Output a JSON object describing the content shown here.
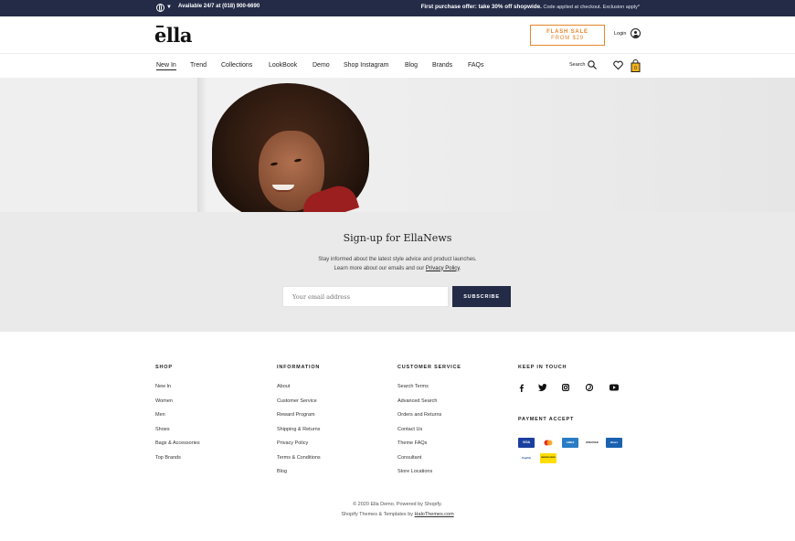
{
  "topbar": {
    "availability": "Available 24/7 at (018) 900-6690",
    "offer_main": "First purchase offer: take 30% off shopwide.",
    "offer_note": "Code applied at checkout. Exclusion apply*"
  },
  "header": {
    "logo": "ella",
    "flash_sale": {
      "line1": "FLASH SALE",
      "line2": "FROM $29"
    },
    "login": "Login"
  },
  "nav": {
    "items": [
      "New In",
      "Trend",
      "Collections",
      "LookBook",
      "Demo",
      "Shop Instagram",
      "Blog",
      "Brands",
      "FAQs"
    ],
    "search_label": "Search"
  },
  "newsletter": {
    "title": "Sign-up for EllaNews",
    "line1": "Stay informed about the latest style advice and product launches.",
    "line2": "Learn more about our emails and our",
    "privacy_link": "Privacy Policy",
    "line2_end": ".",
    "email_placeholder": "Your email address",
    "subscribe": "SUBSCRIBE"
  },
  "footer": {
    "shop": {
      "title": "SHOP",
      "links": [
        "New In",
        "Women",
        "Men",
        "Shoes",
        "Bags & Accessories",
        "Top Brands"
      ]
    },
    "information": {
      "title": "INFORMATION",
      "links": [
        "About",
        "Customer Service",
        "Reward Program",
        "Shipping & Returns",
        "Privacy Policy",
        "Terms & Conditions",
        "Blog"
      ]
    },
    "customer_service": {
      "title": "CUSTOMER SERVICE",
      "links": [
        "Search Terms",
        "Advanced Search",
        "Orders and Returns",
        "Contact Us",
        "Theme FAQs",
        "Consultant",
        "Store Locations"
      ]
    },
    "keep_in_touch": {
      "title": "KEEP IN TOUCH",
      "icons": [
        "facebook-icon",
        "twitter-icon",
        "instagram-icon",
        "pinterest-icon",
        "youtube-icon"
      ]
    },
    "payment": {
      "title": "PAYMENT ACCEPT",
      "cards": [
        "VISA",
        "mastercard",
        "AMEX",
        "DISCOVER",
        "diners",
        "PayPal",
        "western union"
      ]
    },
    "copyright_line1": "© 2020 Ella Demo. Powered by Shopify.",
    "copyright_line2": "Shopify Themes & Templates by",
    "copyright_link": "HaloThemes.com"
  },
  "colors": {
    "navy": "#232b47",
    "flash_orange": "#e6862c"
  }
}
